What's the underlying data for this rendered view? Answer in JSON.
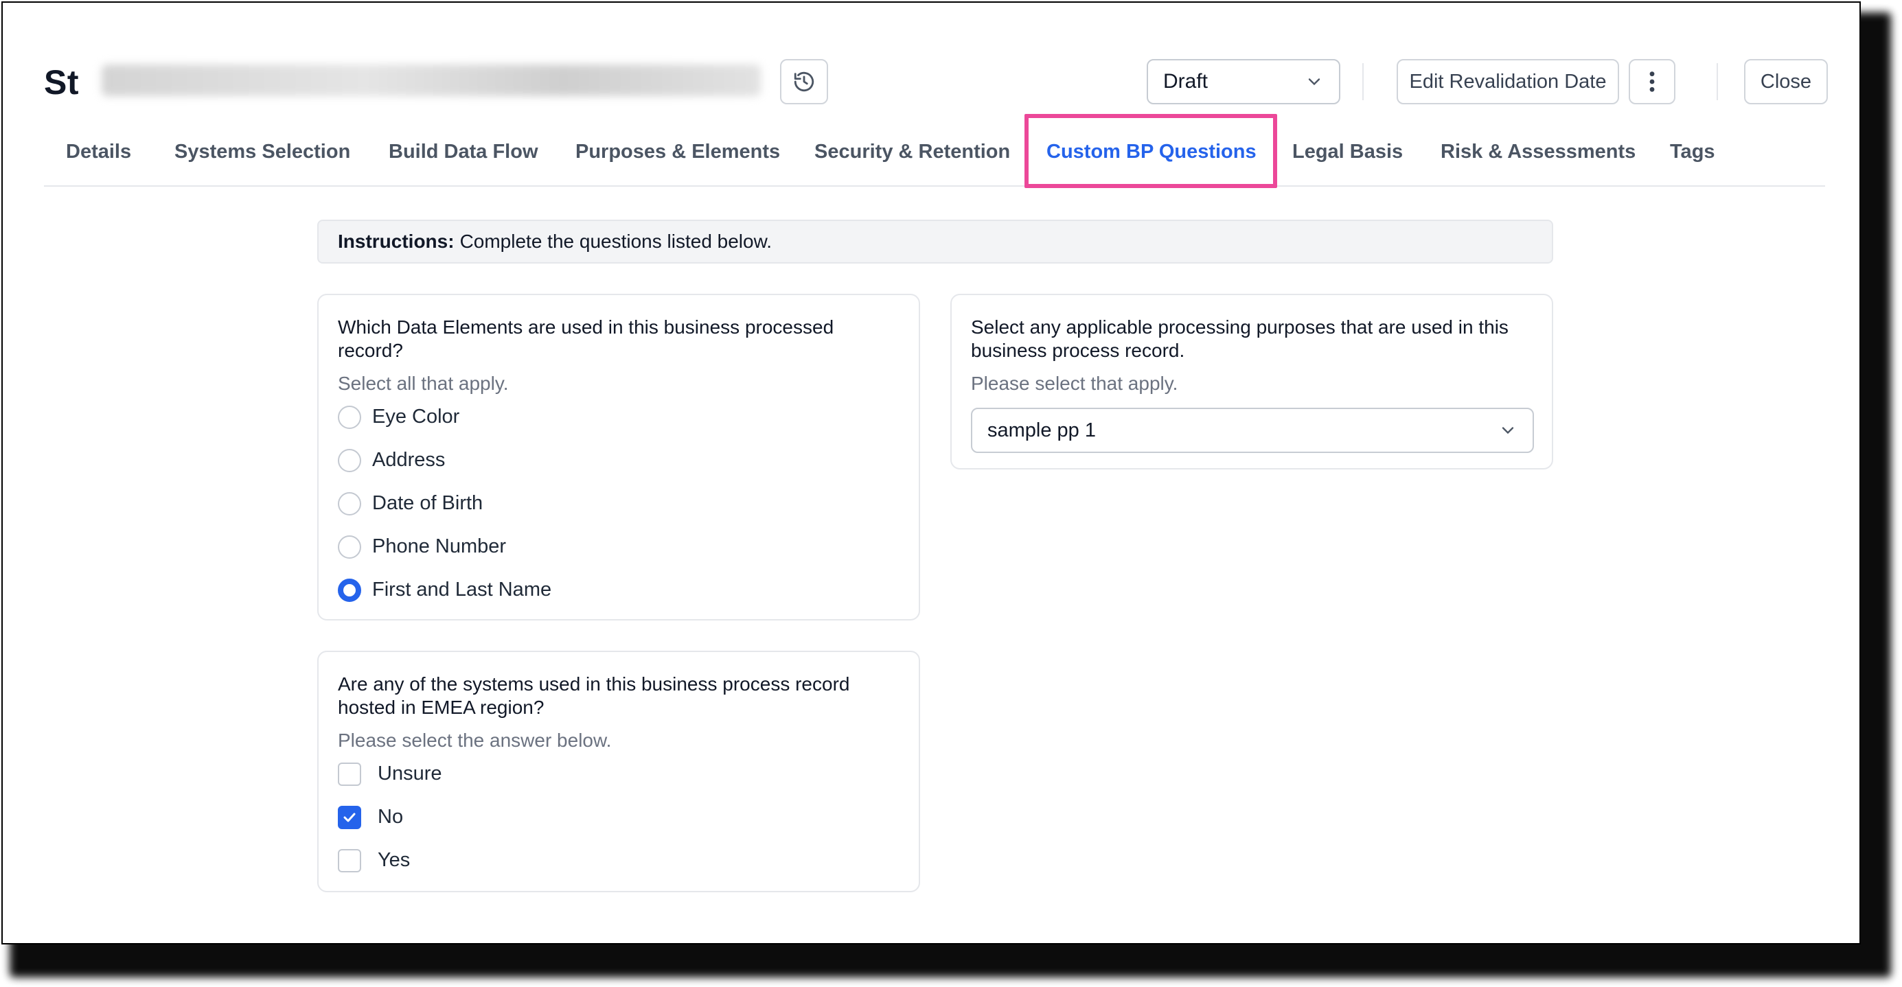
{
  "header": {
    "title_visible": "St",
    "status": {
      "selected": "Draft"
    },
    "edit_revalidation_label": "Edit Revalidation Date",
    "close_label": "Close"
  },
  "tabs": [
    {
      "label": "Details",
      "active": false
    },
    {
      "label": "Systems Selection",
      "active": false
    },
    {
      "label": "Build Data Flow",
      "active": false
    },
    {
      "label": "Purposes & Elements",
      "active": false
    },
    {
      "label": "Security & Retention",
      "active": false
    },
    {
      "label": "Custom BP Questions",
      "active": true
    },
    {
      "label": "Legal Basis",
      "active": false
    },
    {
      "label": "Risk & Assessments",
      "active": false
    },
    {
      "label": "Tags",
      "active": false
    }
  ],
  "instructions": {
    "label": "Instructions:",
    "text": "Complete the questions listed below."
  },
  "questions": [
    {
      "text": "Which Data Elements are used in this business processed record?",
      "hint": "Select all that apply.",
      "options": [
        {
          "label": "Eye Color",
          "selected": false
        },
        {
          "label": "Address",
          "selected": false
        },
        {
          "label": "Date of Birth",
          "selected": false
        },
        {
          "label": "Phone Number",
          "selected": false
        },
        {
          "label": "First and Last Name",
          "selected": true
        }
      ]
    },
    {
      "text": "Select any applicable processing purposes that are used in this business process record.",
      "hint": "Please select that apply.",
      "selected": "sample pp 1"
    },
    {
      "text": "Are any of the systems used in this business process record hosted in EMEA region?",
      "hint": "Please select the answer below.",
      "options": [
        {
          "label": "Unsure",
          "checked": false
        },
        {
          "label": "No",
          "checked": true
        },
        {
          "label": "Yes",
          "checked": false
        }
      ]
    }
  ],
  "colors": {
    "accent": "#2563eb",
    "highlight": "#ec4899"
  }
}
